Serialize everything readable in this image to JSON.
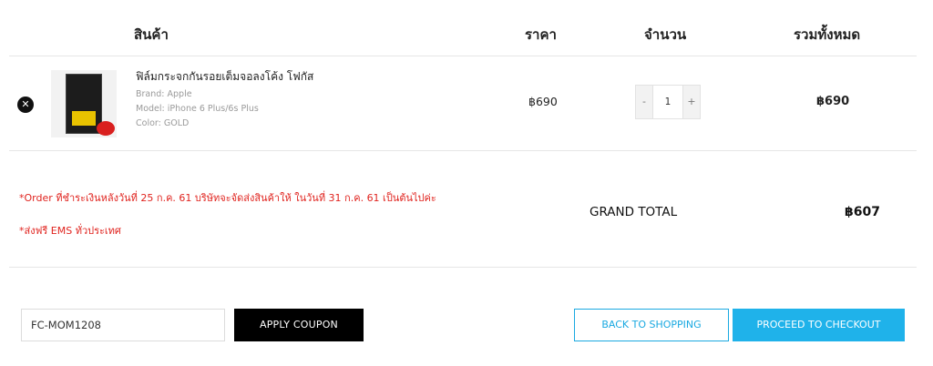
{
  "columns": {
    "product": "สินค้า",
    "price": "ราคา",
    "quantity": "จำนวน",
    "total": "รวมทั้งหมด"
  },
  "item": {
    "remove_icon": "x-circle-icon",
    "name": "ฟิล์มกระจกกันรอยเต็มจอลงโค้ง โฟกัส",
    "brand": "Brand: Apple",
    "model": "Model: iPhone 6 Plus/6s Plus",
    "color": "Color: GOLD",
    "price": "฿690",
    "qty_minus": "-",
    "qty_value": "1",
    "qty_plus": "+",
    "line_total": "฿690"
  },
  "notes": {
    "order_note": "*Order ที่ชำระเงินหลังวันที่ 25 ก.ค. 61 บริษัทจะจัดส่งสินค้าให้ ในวันที่ 31 ก.ค. 61 เป็นต้นไปค่ะ",
    "shipping_note": "*ส่งฟรี EMS ทั่วประเทศ"
  },
  "summary": {
    "grand_total_label": "GRAND TOTAL",
    "grand_total_value": "฿607"
  },
  "actions": {
    "coupon_value": "FC-MOM1208",
    "apply_coupon": "APPLY COUPON",
    "back_to_shopping": "BACK TO SHOPPING",
    "proceed_to_checkout": "PROCEED TO CHECKOUT"
  },
  "colors": {
    "accent_blue": "#1fb2ea",
    "note_red": "#e0231e"
  }
}
